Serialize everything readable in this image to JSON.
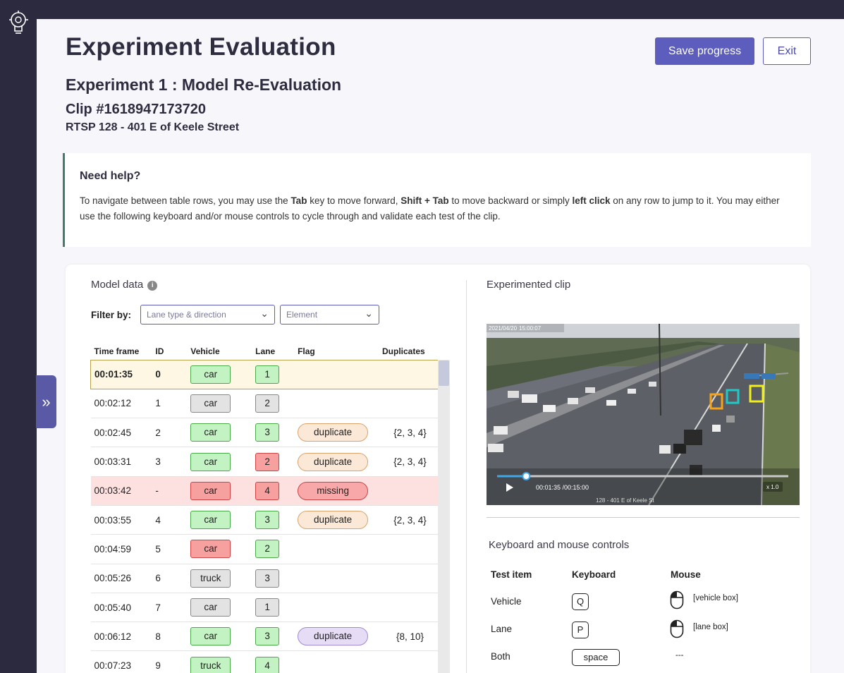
{
  "header": {
    "title": "Experiment Evaluation",
    "experiment": "Experiment 1 : Model Re-Evaluation",
    "clip": "Clip #1618947173720",
    "location": "RTSP 128 - 401 E of Keele Street",
    "save_label": "Save progress",
    "exit_label": "Exit"
  },
  "help": {
    "title": "Need help?",
    "text_1": "To navigate between table rows, you may use the ",
    "key_tab": "Tab",
    "text_2": " key to move forward, ",
    "key_shift_tab": "Shift + Tab",
    "text_3": " to move backward or simply ",
    "left_click": "left click",
    "text_4": " on any row to jump to it. You may either use the following keyboard and/or mouse controls to cycle through and validate each test of the clip."
  },
  "model_data": {
    "title": "Model data",
    "filter_label": "Filter by:",
    "filter_lane_placeholder": "Lane type & direction",
    "filter_element_placeholder": "Element",
    "columns": [
      "Time frame",
      "ID",
      "Vehicle",
      "Lane",
      "Flag",
      "Duplicates"
    ],
    "rows": [
      {
        "time": "00:01:35",
        "id": "0",
        "vehicle": "car",
        "vehicle_color": "green",
        "lane": "1",
        "lane_color": "green",
        "flag": "",
        "flag_style": "",
        "dups": "",
        "state": "selected"
      },
      {
        "time": "00:02:12",
        "id": "1",
        "vehicle": "car",
        "vehicle_color": "gray",
        "lane": "2",
        "lane_color": "gray",
        "flag": "",
        "flag_style": "",
        "dups": "",
        "state": ""
      },
      {
        "time": "00:02:45",
        "id": "2",
        "vehicle": "car",
        "vehicle_color": "green",
        "lane": "3",
        "lane_color": "green",
        "flag": "duplicate",
        "flag_style": "p-dup",
        "dups": "{2, 3, 4}",
        "state": ""
      },
      {
        "time": "00:03:31",
        "id": "3",
        "vehicle": "car",
        "vehicle_color": "green",
        "lane": "2",
        "lane_color": "red",
        "flag": "duplicate",
        "flag_style": "p-dup",
        "dups": "{2, 3, 4}",
        "state": ""
      },
      {
        "time": "00:03:42",
        "id": "-",
        "vehicle": "car",
        "vehicle_color": "red",
        "lane": "4",
        "lane_color": "red",
        "flag": "missing",
        "flag_style": "p-miss",
        "dups": "",
        "state": "missing"
      },
      {
        "time": "00:03:55",
        "id": "4",
        "vehicle": "car",
        "vehicle_color": "green",
        "lane": "3",
        "lane_color": "green",
        "flag": "duplicate",
        "flag_style": "p-dup",
        "dups": "{2, 3, 4}",
        "state": ""
      },
      {
        "time": "00:04:59",
        "id": "5",
        "vehicle": "car",
        "vehicle_color": "red",
        "lane": "2",
        "lane_color": "green",
        "flag": "",
        "flag_style": "",
        "dups": "",
        "state": ""
      },
      {
        "time": "00:05:26",
        "id": "6",
        "vehicle": "truck",
        "vehicle_color": "gray",
        "lane": "3",
        "lane_color": "gray",
        "flag": "",
        "flag_style": "",
        "dups": "",
        "state": ""
      },
      {
        "time": "00:05:40",
        "id": "7",
        "vehicle": "car",
        "vehicle_color": "gray",
        "lane": "1",
        "lane_color": "gray",
        "flag": "",
        "flag_style": "",
        "dups": "",
        "state": ""
      },
      {
        "time": "00:06:12",
        "id": "8",
        "vehicle": "car",
        "vehicle_color": "green",
        "lane": "3",
        "lane_color": "green",
        "flag": "duplicate",
        "flag_style": "p-dup2",
        "dups": "{8, 10}",
        "state": ""
      },
      {
        "time": "00:07:23",
        "id": "9",
        "vehicle": "truck",
        "vehicle_color": "green",
        "lane": "4",
        "lane_color": "green",
        "flag": "",
        "flag_style": "",
        "dups": "",
        "state": ""
      }
    ]
  },
  "clip": {
    "title": "Experimented clip",
    "overlay_date": "2021/04/20",
    "overlay_time": "15:00:07",
    "time_display": "00:01:35 /00:15:00",
    "speed": "x 1.0",
    "progress": 0.1,
    "caption": "128 - 401 E of Keele St"
  },
  "controls": {
    "title": "Keyboard and mouse controls",
    "headers": [
      "Test item",
      "Keyboard",
      "Mouse"
    ],
    "rows": [
      {
        "item": "Vehicle",
        "key": "Q",
        "mouse": "[vehicle box]"
      },
      {
        "item": "Lane",
        "key": "P",
        "mouse": "[lane box]"
      },
      {
        "item": "Both",
        "key": "space",
        "mouse": "---"
      }
    ]
  },
  "icons": {
    "logo": "lightbulb-gear-icon",
    "expander": "double-chevron-right-icon",
    "info": "info-icon",
    "chevron": "chevron-down-icon",
    "play": "play-icon",
    "mouse": "mouse-icon"
  },
  "colors": {
    "accent": "#5d5dbd",
    "sidebar": "#2b2a3f",
    "selected_row": "#fdf7e4",
    "missing_row": "#fde1e1",
    "chip_green": "#c3f2c3",
    "chip_gray": "#e3e3e3",
    "chip_red": "#f6a0a0"
  }
}
